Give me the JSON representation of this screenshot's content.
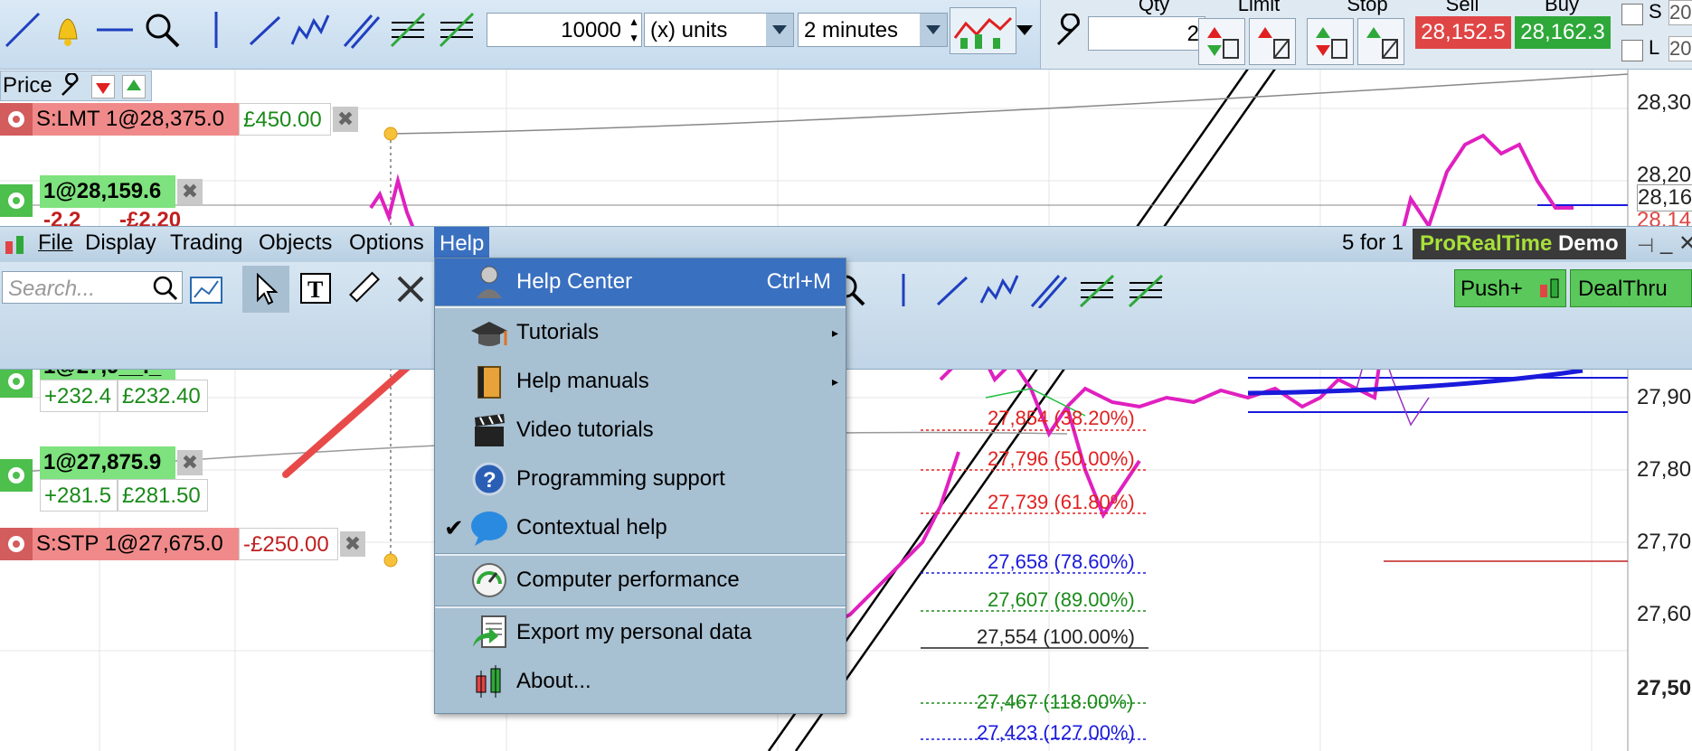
{
  "toolbar": {
    "quantity_value": "10000",
    "units_select": "(x) units",
    "interval_select": "2 minutes",
    "qty_label": "Qty",
    "qty_value": "2",
    "limit_label": "Limit",
    "stop_label": "Stop",
    "sell_label": "Sell",
    "buy_label": "Buy",
    "sell_price": "28,152.5",
    "buy_price": "28,162.3",
    "s_label": "S",
    "l_label": "L",
    "s_value": "20",
    "l_value": "20"
  },
  "price_panel": {
    "title": "Price"
  },
  "orders": [
    {
      "label": "S:LMT 1@28,375.0",
      "pnl": "£450.00"
    },
    {
      "label": "1@28,159.6",
      "pnl_points": "-2.2",
      "pnl": "-£2.20"
    },
    {
      "label": "1@27,9__._",
      "pnl_points": "+232.4",
      "pnl": "£232.40"
    },
    {
      "label": "1@27,875.9",
      "pnl_points": "+281.5",
      "pnl": "£281.50"
    },
    {
      "label": "S:STP 1@27,675.0",
      "pnl": "-£250.00"
    }
  ],
  "menubar": {
    "items": [
      "File",
      "Display",
      "Trading",
      "Objects",
      "Options",
      "Help"
    ],
    "right_text": "5 for 1",
    "brand": "ProRealTime",
    "brand_suffix": "Demo"
  },
  "toolbar2": {
    "search_placeholder": "Search...",
    "push_label": "Push+",
    "dealthru_label": "DealThru"
  },
  "help_menu": {
    "items": [
      {
        "label": "Help Center",
        "shortcut": "Ctrl+M",
        "icon": "help-center-icon"
      },
      {
        "label": "Tutorials",
        "icon": "graduation-cap-icon"
      },
      {
        "label": "Help manuals",
        "icon": "book-icon"
      },
      {
        "label": "Video tutorials",
        "icon": "clapperboard-icon"
      },
      {
        "label": "Programming support",
        "icon": "question-icon"
      },
      {
        "label": "Contextual help",
        "icon": "speech-bubble-icon"
      },
      {
        "label": "Computer performance",
        "icon": "gauge-icon"
      },
      {
        "label": "Export my personal data",
        "icon": "export-icon"
      },
      {
        "label": "About...",
        "icon": "candlestick-icon"
      }
    ]
  },
  "price_axis": [
    "28,30",
    "28,20",
    "28,16",
    "28,14",
    "27,90",
    "27,80",
    "27,70",
    "27,60",
    "27,50"
  ],
  "fibonacci": [
    {
      "label": "27,854 (38.20%)",
      "color": "#e02020"
    },
    {
      "label": "27,796 (50.00%)",
      "color": "#e02020"
    },
    {
      "label": "27,739 (61.80%)",
      "color": "#e02020"
    },
    {
      "label": "27,658 (78.60%)",
      "color": "#1a1adb"
    },
    {
      "label": "27,607 (89.00%)",
      "color": "#1a8a1a"
    },
    {
      "label": "27,554 (100.00%)",
      "color": "#222222"
    },
    {
      "label": "27,467 (118.00%)",
      "color": "#1a8a1a"
    },
    {
      "label": "27,423 (127.00%)",
      "color": "#1a1adb"
    }
  ],
  "colors": {
    "accent": "#3a70c0",
    "sell": "#e04545",
    "buy": "#2fa83a",
    "order_green": "#7ee27e",
    "order_red": "#f08a8a"
  }
}
